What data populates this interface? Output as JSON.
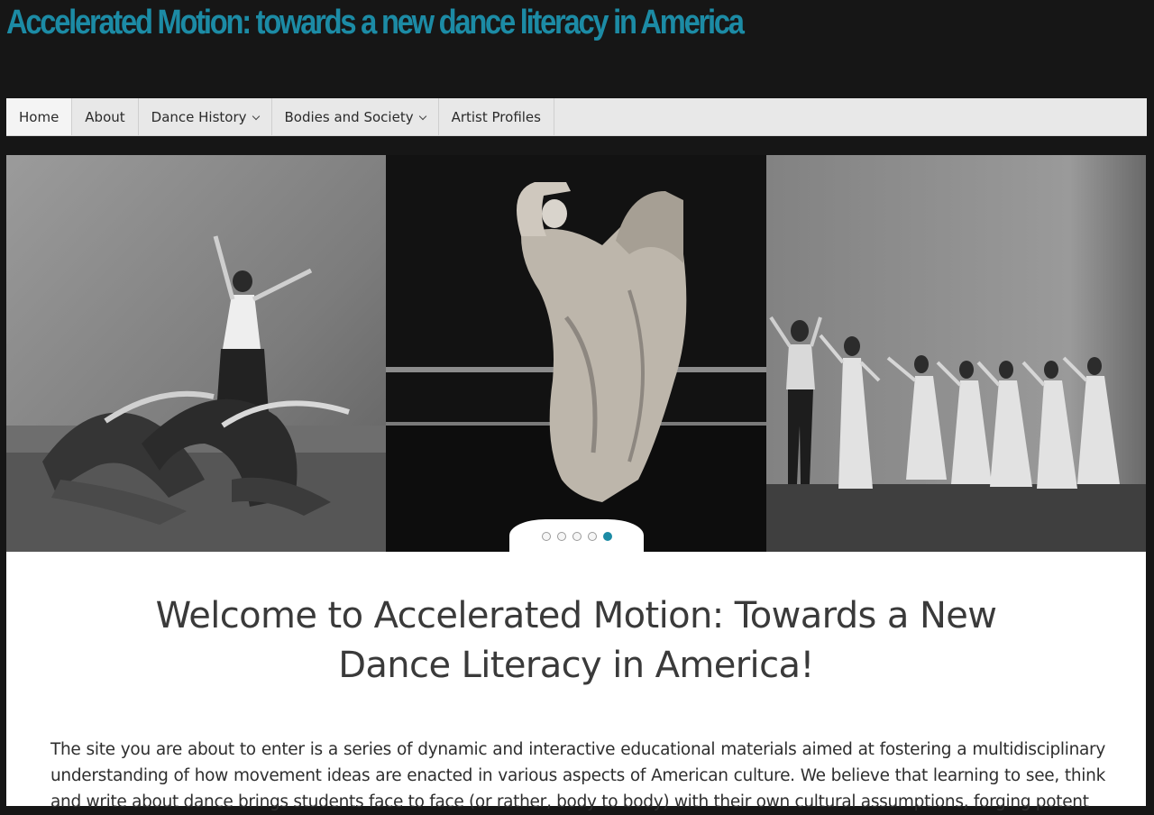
{
  "site": {
    "title": "Accelerated Motion: towards a new dance literacy in America"
  },
  "nav": {
    "items": [
      {
        "label": "Home",
        "has_submenu": false,
        "active": true
      },
      {
        "label": "About",
        "has_submenu": false,
        "active": false
      },
      {
        "label": "Dance History",
        "has_submenu": true,
        "active": false
      },
      {
        "label": "Bodies and Society",
        "has_submenu": true,
        "active": false
      },
      {
        "label": "Artist Profiles",
        "has_submenu": false,
        "active": false
      }
    ]
  },
  "slider": {
    "slides": [
      {
        "description": "black-and-white photo of dancers in a group pose"
      },
      {
        "description": "black-and-white photo of a solo dancer in a draped costume"
      },
      {
        "description": "black-and-white photo of a dance ensemble on stage"
      }
    ],
    "dot_count": 5,
    "active_dot": 4
  },
  "main": {
    "heading_line1": "Welcome to Accelerated Motion: Towards a New",
    "heading_line2": "Dance Literacy in America!",
    "intro": "The site you are about to enter is a series of dynamic and interactive educational materials aimed at fostering a multidisciplinary understanding of how movement ideas are enacted in various aspects of American culture. We believe that learning to see, think and write about dance brings students face to face (or rather, body to body) with their own cultural assumptions, forging potent"
  },
  "colors": {
    "accent": "#1c8ba5",
    "page_background": "#161616",
    "nav_background": "#e8e8e8"
  }
}
